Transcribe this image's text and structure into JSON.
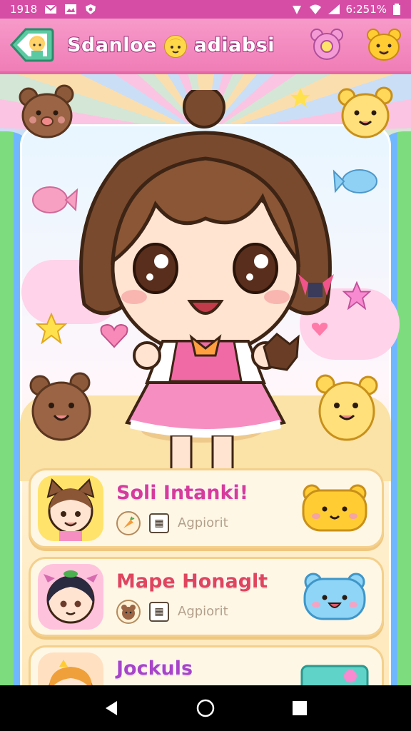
{
  "status_bar": {
    "time": "1918",
    "right_text": "6:251%",
    "icons": [
      "mail-icon",
      "photo-icon",
      "shield-icon",
      "location-icon",
      "wifi-icon",
      "signal-icon",
      "battery-icon"
    ]
  },
  "header": {
    "title": "Sdanloe",
    "title_suffix": "adiabsi",
    "back_icon": "back-arrow-icon",
    "actions": [
      {
        "name": "pink-bear-button",
        "icon": "pink-bear-icon"
      },
      {
        "name": "yellow-bear-button",
        "icon": "yellow-bear-icon"
      }
    ]
  },
  "colors": {
    "header_bg": "#f07db7",
    "status_bg": "#d64da6",
    "card_bg": "#fff7e6",
    "accent_pink": "#d63b9c",
    "accent_red": "#e0455d",
    "accent_purple": "#a844c9"
  },
  "list": [
    {
      "name": "Soli Intanki!",
      "name_color": "#d63b9c",
      "meta": "Agpiorit",
      "avatar_bg": "#ffe36b",
      "avatar_icon": "cat-girl-avatar",
      "action_icon": "yellow-bear-face-icon"
    },
    {
      "name": "Mape Honaglt",
      "name_color": "#e0455d",
      "meta": "Agpiorit",
      "avatar_bg": "#ffc2dd",
      "avatar_icon": "dark-hair-girl-avatar",
      "action_icon": "blue-bear-face-icon"
    },
    {
      "name": "Jockuls",
      "name_color": "#a844c9",
      "meta": "",
      "avatar_bg": "#ffe1c2",
      "avatar_icon": "orange-hair-avatar",
      "action_icon": "teal-card-icon"
    }
  ],
  "nav": {
    "buttons": [
      "back-nav-icon",
      "home-nav-icon",
      "recents-nav-icon"
    ]
  }
}
